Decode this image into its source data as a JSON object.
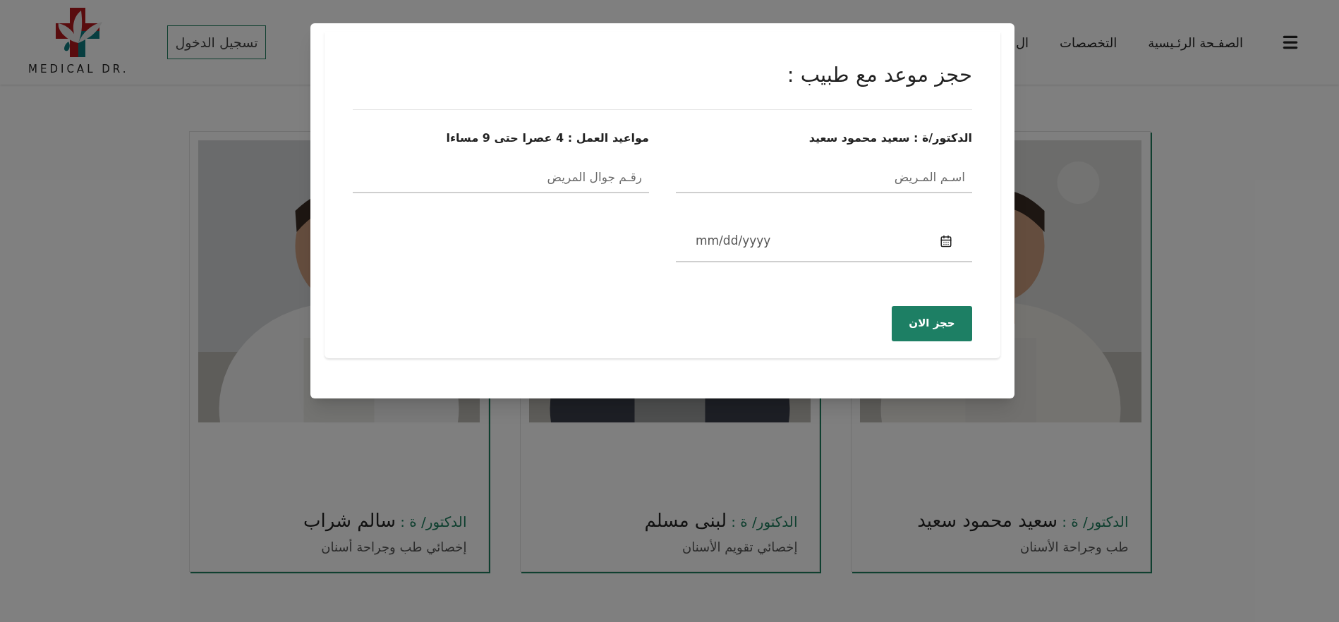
{
  "header": {
    "logo_text": "MEDICAL DR.",
    "login_button": "تسجيل الدخول",
    "nav": [
      {
        "label": "الصفـحة الرئـيسية"
      },
      {
        "label": "التخصصات"
      },
      {
        "label": "ال"
      }
    ]
  },
  "doctors": [
    {
      "title": "الدكتور/ ة :",
      "name": "سعيد محمود سعيد",
      "specialty": "طب وجراحة الأسنان"
    },
    {
      "title": "الدكتور/ ة :",
      "name": "لبنى مسلم",
      "specialty": "إخصائي تقويم الأسنان"
    },
    {
      "title": "الدكتور/ ة :",
      "name": "سالم شراب",
      "specialty": "إخصائي طب وجراحة أسنان"
    }
  ],
  "modal": {
    "title": "حجز موعد مع طبيب :",
    "doctor": "الدكتور/ة : سعيد محمود سعيد",
    "hours": "مواعيد العمل : 4 عصرا حتى 9 مساءا",
    "fields": [
      {
        "kind": "text",
        "placeholder": "اسـم المـريض"
      },
      {
        "kind": "text",
        "placeholder": "رقـم جوال المريض"
      },
      {
        "kind": "date",
        "placeholder": "mm/dd/yyyy"
      }
    ],
    "submit": "حجز الان"
  }
}
